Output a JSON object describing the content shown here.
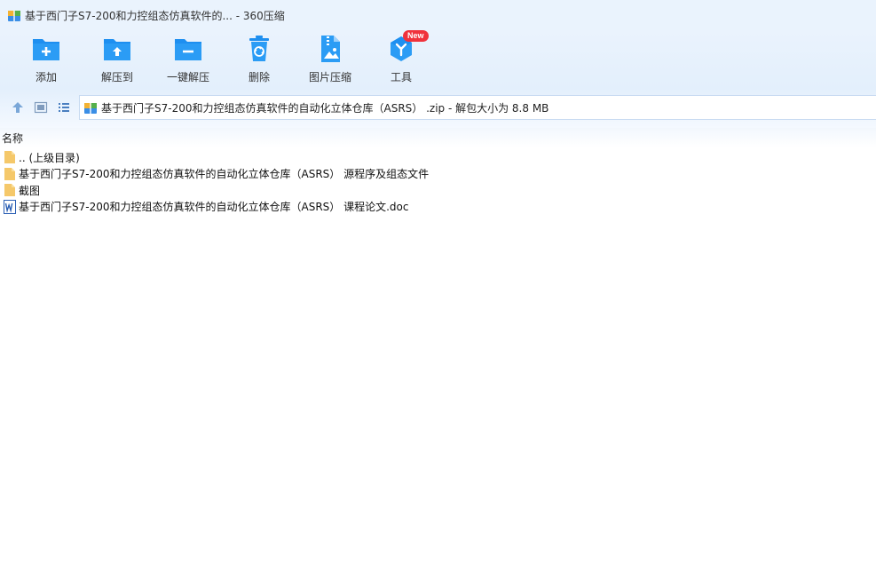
{
  "window": {
    "title": "基于西门子S7-200和力控组态仿真软件的... - 360压缩"
  },
  "toolbar": {
    "items": [
      {
        "label": "添加",
        "icon": "add-folder-icon"
      },
      {
        "label": "解压到",
        "icon": "extract-to-icon"
      },
      {
        "label": "一键解压",
        "icon": "one-click-extract-icon"
      },
      {
        "label": "删除",
        "icon": "trash-icon"
      },
      {
        "label": "图片压缩",
        "icon": "image-compress-icon"
      },
      {
        "label": "工具",
        "icon": "tools-icon",
        "badge": "New"
      }
    ]
  },
  "addressbar": {
    "text": "基于西门子S7-200和力控组态仿真软件的自动化立体仓库（ASRS） .zip - 解包大小为 8.8 MB"
  },
  "filelist": {
    "header": "名称",
    "rows": [
      {
        "name": ".. (上级目录)",
        "type": "folder"
      },
      {
        "name": "基于西门子S7-200和力控组态仿真软件的自动化立体仓库（ASRS） 源程序及组态文件",
        "type": "folder"
      },
      {
        "name": "截图",
        "type": "folder"
      },
      {
        "name": "基于西门子S7-200和力控组态仿真软件的自动化立体仓库（ASRS） 课程论文.doc",
        "type": "word"
      }
    ]
  },
  "colors": {
    "accent": "#1e8ff0",
    "folder": "#f5c86a",
    "badge": "#f0323c"
  }
}
